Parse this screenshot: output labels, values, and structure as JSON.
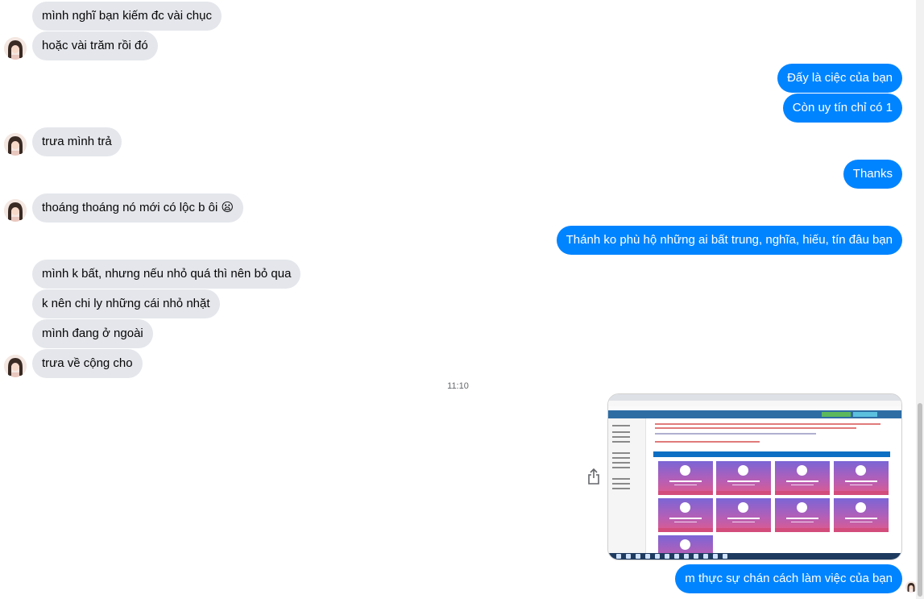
{
  "incoming_messages": [
    "mình nghĩ bạn kiếm đc vài chục",
    "hoặc vài trăm rồi đó",
    "trưa mình trả",
    "thoáng thoáng nó mới có lộc b ôi 😦",
    "mình k bất, nhưng nếu nhỏ quá thì nên bỏ qua",
    "k nên chi ly những cái nhỏ nhặt",
    "mình đang ở ngoài",
    "trưa về cộng cho"
  ],
  "outgoing_messages": [
    "Đấy là ciệc của bạn",
    "Còn uy tín chỉ có 1",
    "Thanks",
    "Thánh ko phù hộ những ai bất trung, nghĩa, hiếu, tín đâu bạn",
    "m thực sự chán cách làm việc của bạn"
  ],
  "timestamp": "11:10",
  "icons": {
    "share": "share-icon",
    "avatar": "contact-avatar"
  },
  "colors": {
    "outgoing_bubble": "#0084ff",
    "incoming_bubble": "#e4e6eb",
    "timestamp": "#65676b"
  }
}
